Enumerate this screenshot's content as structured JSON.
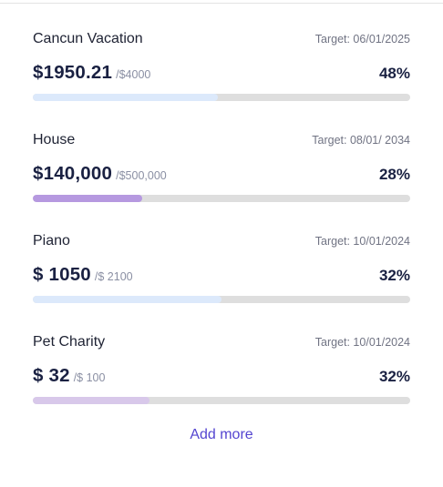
{
  "goals": [
    {
      "name": "Cancun Vacation",
      "target": "Target: 06/01/2025",
      "saved": "$1950.21",
      "total": "/$4000",
      "percent": "48%",
      "progress": 0.49,
      "color": "#dce9fb"
    },
    {
      "name": "House",
      "target": "Target: 08/01/ 2034",
      "saved": "$140,000",
      "total": "/$500,000",
      "percent": "28%",
      "progress": 0.29,
      "color": "#b699e0"
    },
    {
      "name": "Piano",
      "target": "Target: 10/01/2024",
      "saved": "$ 1050",
      "total": "/$ 2100",
      "percent": "32%",
      "progress": 0.5,
      "color": "#dce9fb"
    },
    {
      "name": "Pet Charity",
      "target": "Target: 10/01/2024",
      "saved": "$ 32",
      "total": "/$ 100",
      "percent": "32%",
      "progress": 0.31,
      "color": "#d8c8ea"
    }
  ],
  "actions": {
    "add_more_label": "Add more"
  }
}
